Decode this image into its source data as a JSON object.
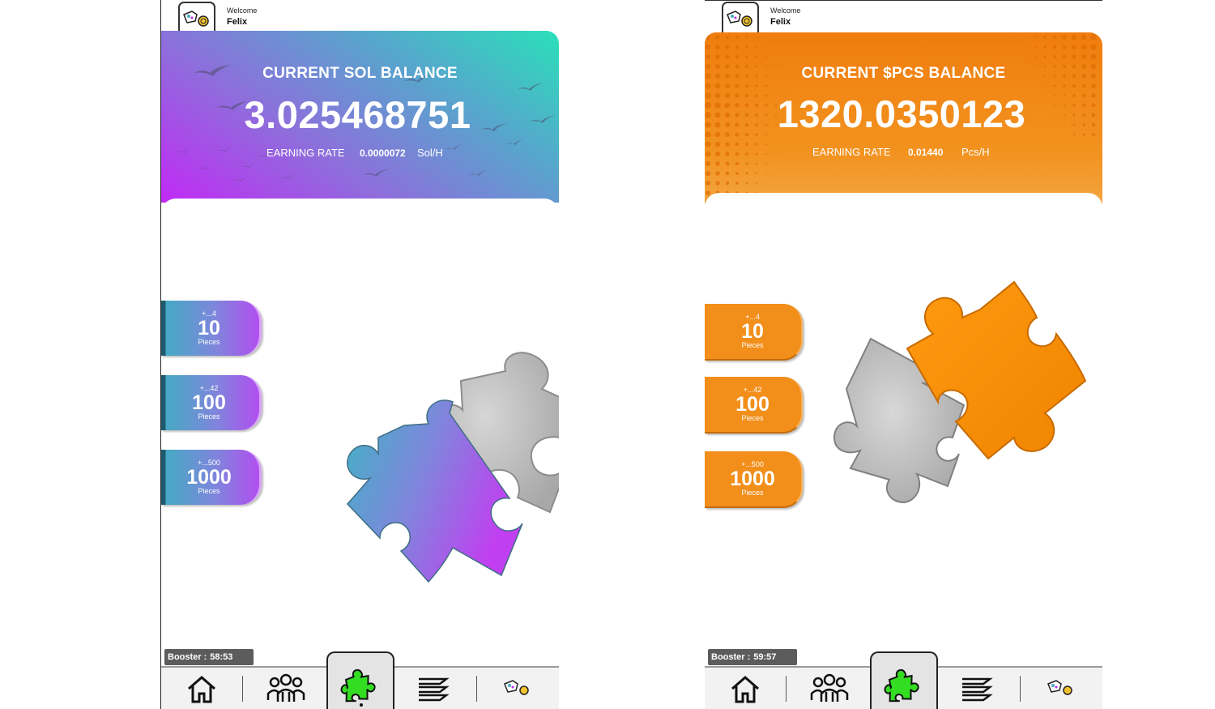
{
  "screens": [
    {
      "id": "sol",
      "header": {
        "welcome": "Welcome",
        "username": "Felix",
        "logo_icon": "puzzle-coin-logo-icon"
      },
      "balance": {
        "title": "CURRENT SOL BALANCE",
        "value": "3.025468751",
        "rate_label": "EARNING RATE",
        "rate_value": "0.0000072",
        "rate_unit": "Sol/H"
      },
      "packs": [
        {
          "bonus": "+...4",
          "count": "10",
          "unit": "Pieces"
        },
        {
          "bonus": "+...42",
          "count": "100",
          "unit": "Pieces"
        },
        {
          "bonus": "+...500",
          "count": "1000",
          "unit": "Pieces"
        }
      ],
      "booster": {
        "label": "Booster :",
        "time": "58:53"
      },
      "theme": {
        "accent_start": "#c12af5",
        "accent_end": "#2ae0b9"
      }
    },
    {
      "id": "pcs",
      "header": {
        "welcome": "Welcome",
        "username": "Felix",
        "logo_icon": "puzzle-coin-logo-icon"
      },
      "balance": {
        "title": "CURRENT $PCS BALANCE",
        "value": "1320.0350123",
        "rate_label": "EARNING RATE",
        "rate_value": "0.01440",
        "rate_unit": "Pcs/H"
      },
      "packs": [
        {
          "bonus": "+...4",
          "count": "10",
          "unit": "Pieces"
        },
        {
          "bonus": "+...42",
          "count": "100",
          "unit": "Pieces"
        },
        {
          "bonus": "+...500",
          "count": "1000",
          "unit": "Pieces"
        }
      ],
      "booster": {
        "label": "Booster :",
        "time": "59:57"
      },
      "theme": {
        "accent": "#f28e1a"
      }
    }
  ],
  "nav": {
    "items": [
      "home-icon",
      "team-icon",
      "puzzle-icon",
      "list-icon",
      "puzzle-coin-logo-icon"
    ],
    "active": "puzzle-icon",
    "active_color": "#33dd22"
  }
}
